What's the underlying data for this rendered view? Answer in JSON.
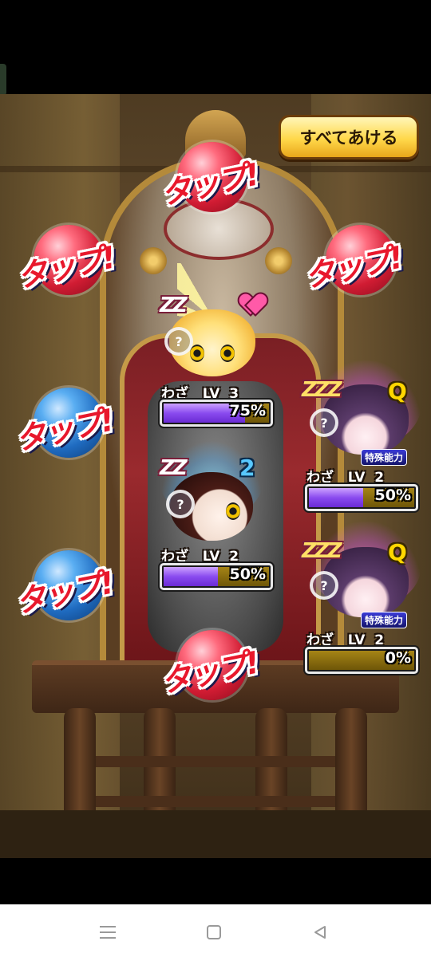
{
  "buttons": {
    "open_all": "すべてあける",
    "tap_label": "タップ!"
  },
  "orbs": [
    {
      "id": "top",
      "color": "red"
    },
    {
      "id": "left-upper",
      "color": "red"
    },
    {
      "id": "right-upper",
      "color": "red"
    },
    {
      "id": "left-middle",
      "color": "blue"
    },
    {
      "id": "left-lower",
      "color": "blue"
    },
    {
      "id": "bottom",
      "color": "red"
    }
  ],
  "characters": [
    {
      "id": "yellow",
      "sleep_text": "ZZ",
      "skill_label": "わざ",
      "level_text": "LV  3",
      "progress_text": "75%",
      "progress": 0.75
    },
    {
      "id": "purple-1",
      "sleep_text": "ZZZ",
      "badge": "特殊能力",
      "skill_label": "わざ",
      "level_text": "LV  2",
      "progress_text": "50%",
      "progress": 0.5
    },
    {
      "id": "dark",
      "sleep_text": "ZZ",
      "skill_label": "わざ",
      "level_text": "LV  2",
      "progress_text": "50%",
      "progress": 0.5
    },
    {
      "id": "purple-2",
      "sleep_text": "ZZZ",
      "badge": "特殊能力",
      "skill_label": "わざ",
      "level_text": "LV  2",
      "progress_text": "0%",
      "progress": 0.0
    }
  ],
  "icons": {
    "magnify": "?",
    "question_badge": "Q",
    "number_badge": "2"
  },
  "navbar": {
    "recent_icon": "recent-apps-icon",
    "home_icon": "home-icon",
    "back_icon": "back-icon"
  },
  "colors": {
    "tap_red": "#e8182c",
    "button_gold": "#ffd84a",
    "bar_purple": "#8a4bef",
    "bar_gold": "#a58416"
  }
}
